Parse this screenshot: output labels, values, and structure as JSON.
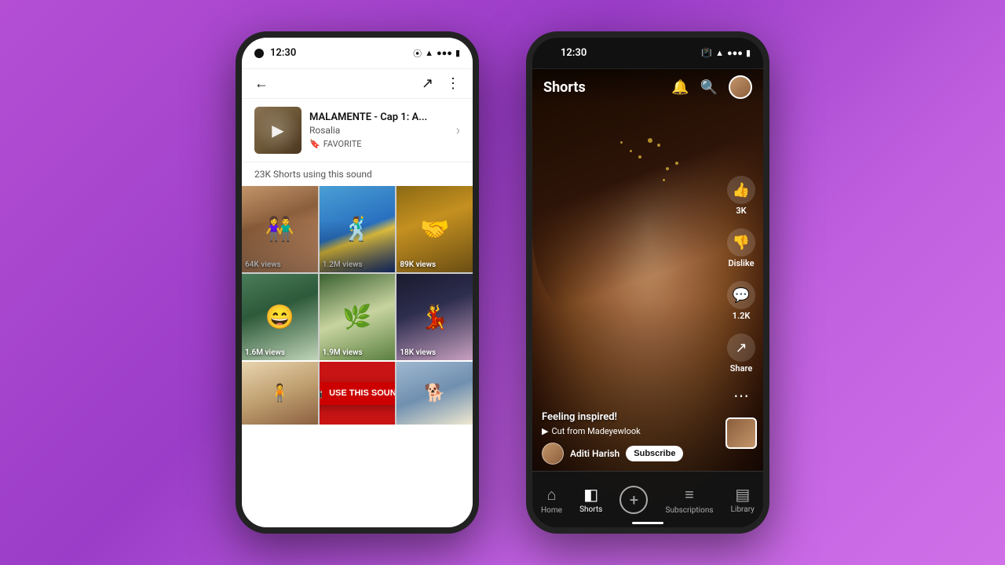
{
  "background": {
    "gradient": "linear-gradient(135deg, #b44fd4, #9b3dc8, #c060e0, #d070e8)"
  },
  "phone1": {
    "status": {
      "time": "12:30",
      "icons": "⦿ ▲ 📶 🔋"
    },
    "header": {
      "back_icon": "←",
      "share_icon": "↗",
      "more_icon": "⋮"
    },
    "sound": {
      "title": "MALAMENTE - Cap 1: A...",
      "artist": "Rosalia",
      "favorite_label": "FAVORITE",
      "arrow": "›"
    },
    "shorts_count": "23K Shorts using this sound",
    "videos": [
      {
        "views": "64K views"
      },
      {
        "views": "1.2M views"
      },
      {
        "views": "89K views"
      },
      {
        "views": "1.6M views"
      },
      {
        "views": "1.9M views"
      },
      {
        "views": "18K views"
      }
    ],
    "use_sound_btn": "USE THIS SOUND"
  },
  "phone2": {
    "status": {
      "time": "12:30",
      "icons": "🔔 📶 🔋"
    },
    "header": {
      "title": "Shorts",
      "bell_icon": "🔔",
      "search_icon": "🔍"
    },
    "video": {
      "caption": "Feeling inspired!",
      "cut_from": "Cut from Madeyewlook",
      "channel_name": "Aditi Harish",
      "subscribe_label": "Subscribe"
    },
    "actions": {
      "like_count": "3K",
      "dislike_label": "Dislike",
      "comment_count": "1.2K",
      "share_label": "Share"
    },
    "nav": [
      {
        "icon": "⌂",
        "label": "Home",
        "active": false
      },
      {
        "icon": "◧",
        "label": "Shorts",
        "active": true
      },
      {
        "icon": "+",
        "label": "",
        "active": false
      },
      {
        "icon": "📋",
        "label": "Subscriptions",
        "active": false
      },
      {
        "icon": "▤",
        "label": "Library",
        "active": false
      }
    ]
  }
}
